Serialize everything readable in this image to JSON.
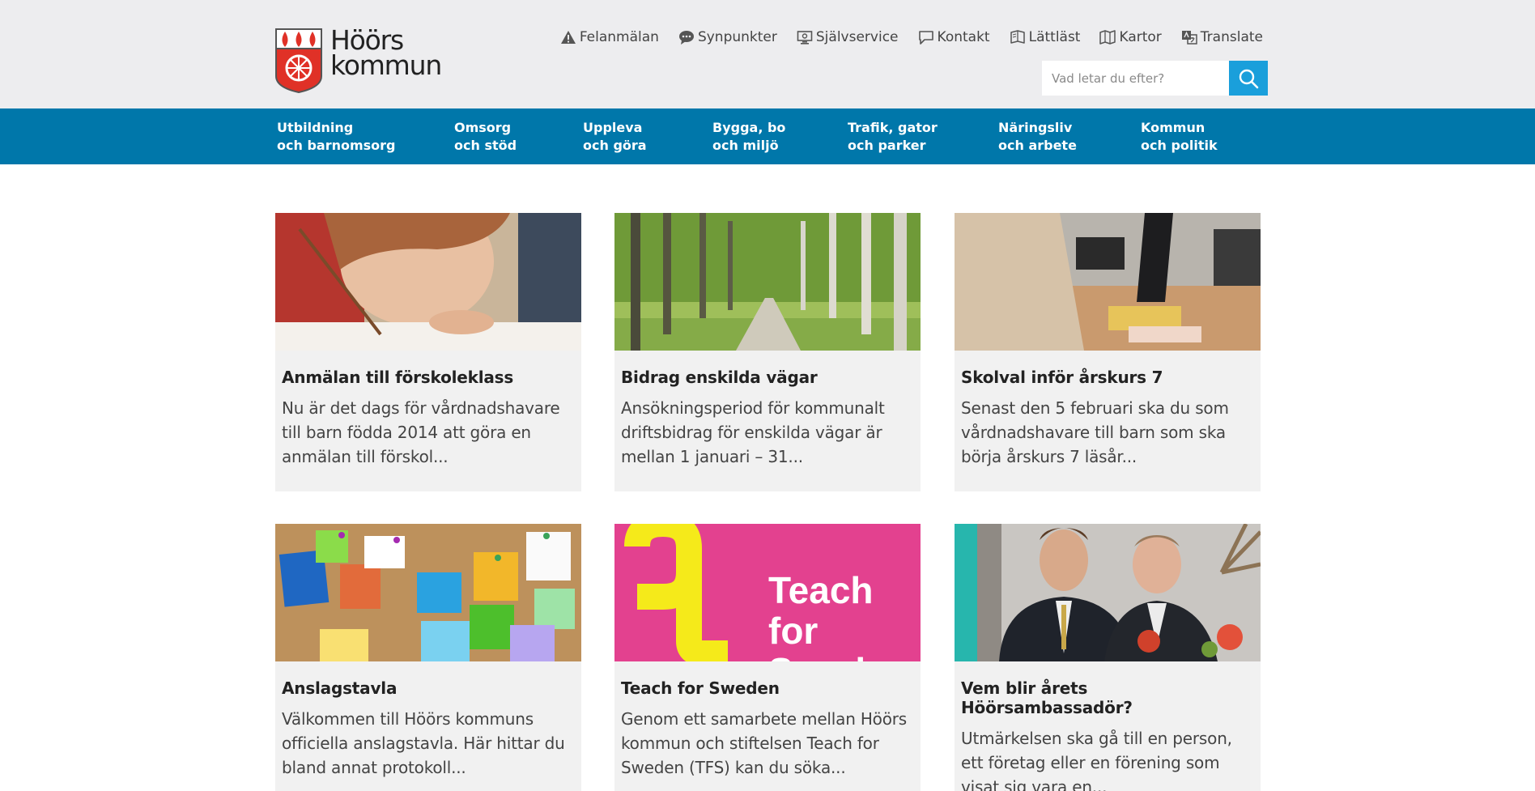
{
  "logo": {
    "line1": "Höörs",
    "line2": "kommun"
  },
  "quicklinks": [
    {
      "label": "Felanmälan",
      "icon": "warning-icon"
    },
    {
      "label": "Synpunkter",
      "icon": "chat-bubble-icon"
    },
    {
      "label": "Självservice",
      "icon": "monitor-icon"
    },
    {
      "label": "Kontakt",
      "icon": "speech-icon"
    },
    {
      "label": "Lättläst",
      "icon": "book-icon"
    },
    {
      "label": "Kartor",
      "icon": "map-icon"
    },
    {
      "label": "Translate",
      "icon": "translate-icon"
    }
  ],
  "search": {
    "placeholder": "Vad letar du efter?",
    "icon": "search-icon"
  },
  "nav": [
    {
      "line1": "Utbildning",
      "line2": "och barnomsorg"
    },
    {
      "line1": "Omsorg",
      "line2": "och stöd"
    },
    {
      "line1": "Uppleva",
      "line2": "och göra"
    },
    {
      "line1": "Bygga, bo",
      "line2": "och miljö"
    },
    {
      "line1": "Trafik, gator",
      "line2": "och parker"
    },
    {
      "line1": "Näringsliv",
      "line2": "och arbete"
    },
    {
      "line1": "Kommun",
      "line2": "och politik"
    }
  ],
  "cards": [
    {
      "title": "Anmälan till förskoleklass",
      "text": "Nu är det dags för vårdnadshavare till barn födda 2014 att göra en anmälan till förskol..."
    },
    {
      "title": "Bidrag enskilda vägar",
      "text": "Ansökningsperiod för kommunalt driftsbidrag för enskilda vägar är mellan 1 januari – 31..."
    },
    {
      "title": "Skolval inför årskurs 7",
      "text": "Senast den 5 februari ska du som vårdnadshavare till barn som ska börja årskurs 7 läsår..."
    },
    {
      "title": "Anslagstavla",
      "text": "Välkommen till Höörs kommuns officiella anslagstavla. Här hittar du bland annat protokoll..."
    },
    {
      "title": "Teach for Sweden",
      "text": "Genom ett samarbete mellan Höörs kommun och stiftelsen Teach for Sweden (TFS) kan du söka...",
      "image_text": "Teach for Sweden"
    },
    {
      "title": "Vem blir årets Höörsambassadör?",
      "text": "Utmärkelsen ska gå till en person, ett företag eller en förening som visat sig vara en..."
    }
  ],
  "colors": {
    "nav_bg": "#0077aa",
    "search_btn": "#1a9fdb",
    "card_bg": "#f1f1f1",
    "topbar_bg": "#ededef"
  }
}
